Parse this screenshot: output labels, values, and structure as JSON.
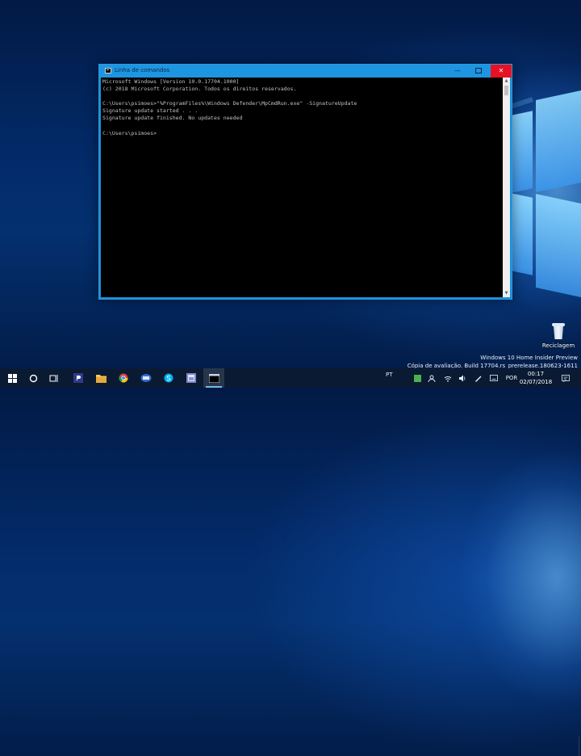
{
  "window": {
    "title": "Linha de comandos",
    "controls": {
      "minimize": "—",
      "close": "✕"
    },
    "console_text": "Microsoft Windows [Version 10.0.17704.1000]\n(c) 2018 Microsoft Corporation. Todos os direitos reservados.\n\nC:\\Users\\psimoes>\"%ProgramFiles%\\Windows Defender\\MpCmdRun.exe\" -SignatureUpdate\nSignature update started . . .\nSignature update finished. No updates needed\n\nC:\\Users\\psimoes>",
    "scrollbar": {
      "up": "▲",
      "down": "▼"
    }
  },
  "desktop": {
    "recycle_bin_label": "Reciclagem",
    "watermark_line1": "Windows 10 Home Insider Preview",
    "watermark_line2": "Cópia de avaliação. Build 17704.rs_prerelease.180623-1611"
  },
  "taskbar": {
    "language_indicator": "PT",
    "input_language": "POR",
    "clock_time": "00:17",
    "clock_date": "02/07/2018",
    "pinned": [
      "windows-logo",
      "cortana-circle",
      "task-view",
      "app-p",
      "file-explorer",
      "chrome",
      "app-blue",
      "skype",
      "photo-app",
      "command-prompt"
    ],
    "accent": "#76b9ed"
  },
  "colors": {
    "titlebar": "#1e95e0",
    "close_button": "#e81123",
    "console_background": "#000000",
    "console_text": "#c0c0c0",
    "taskbar": "#0a1a33"
  }
}
